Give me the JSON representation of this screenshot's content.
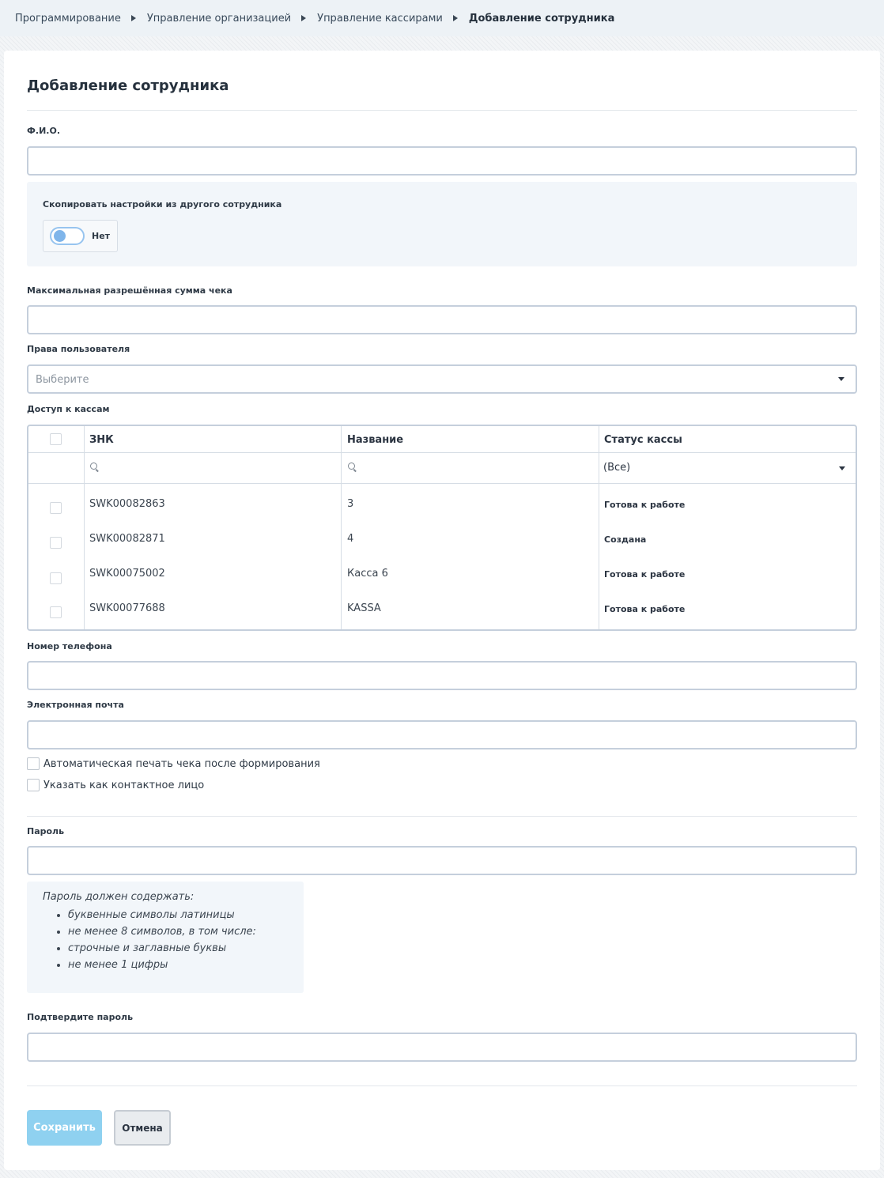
{
  "breadcrumb": {
    "items": [
      "Программирование",
      "Управление организацией",
      "Управление кассирами"
    ],
    "current": "Добавление сотрудника"
  },
  "page": {
    "title": "Добавление сотрудника"
  },
  "form": {
    "fio_label": "Ф.И.О.",
    "fio_value": "",
    "copy_settings": {
      "label": "Скопировать настройки из другого сотрудника",
      "toggle_text": "Нет",
      "enabled": false
    },
    "max_sum_label": "Максимальная разрешённая сумма чека",
    "max_sum_value": "",
    "rights": {
      "label": "Права пользователя",
      "placeholder": "Выберите"
    },
    "cash_access_label": "Доступ к кассам",
    "phone_label": "Номер телефона",
    "phone_value": "",
    "email_label": "Электронная почта",
    "email_value": "",
    "auto_print_label": "Автоматическая печать чека после формирования",
    "contact_person_label": "Указать как контактное лицо",
    "password_label": "Пароль",
    "password_value": "",
    "password_hint": {
      "title": "Пароль должен содержать:",
      "items": [
        "буквенные символы латиницы",
        "не менее 8 символов, в том числе:",
        "строчные и заглавные буквы",
        "не менее 1 цифры"
      ]
    },
    "confirm_password_label": "Подтвердите пароль",
    "confirm_password_value": ""
  },
  "table": {
    "columns": [
      "ЗНК",
      "Название",
      "Статус кассы"
    ],
    "status_filter": "(Все)",
    "rows": [
      {
        "znk": "SWK00082863",
        "name": "3",
        "status": "Готова к работе"
      },
      {
        "znk": "SWK00082871",
        "name": "4",
        "status": "Создана"
      },
      {
        "znk": "SWK00075002",
        "name": "Касса 6",
        "status": "Готова к работе"
      },
      {
        "znk": "SWK00077688",
        "name": "KASSA",
        "status": "Готова к работе"
      }
    ]
  },
  "buttons": {
    "save": "Сохранить",
    "cancel": "Отмена"
  },
  "colors": {
    "save_button": "#8fd1f0",
    "toggle_accent": "#7fb5ea",
    "input_border": "#c5cfdc"
  }
}
